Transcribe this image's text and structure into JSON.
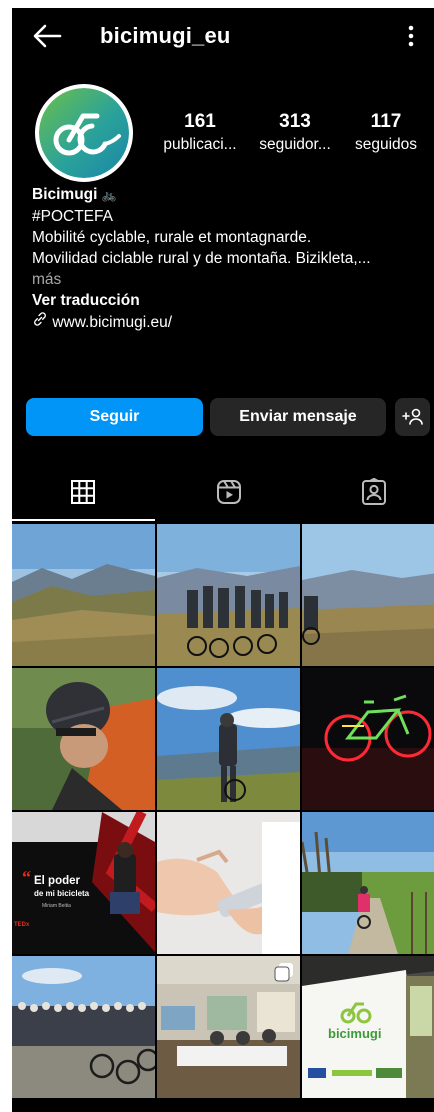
{
  "header": {
    "username": "bicimugi_eu"
  },
  "stats": [
    {
      "value": "161",
      "label": "publicaci..."
    },
    {
      "value": "313",
      "label": "seguidor..."
    },
    {
      "value": "117",
      "label": "seguidos"
    }
  ],
  "bio": {
    "name": "Bicimugi",
    "name_emoji": "🚲",
    "hashtag": "#POCTEFA",
    "line1": "Mobilité cyclable, rurale et montagnarde.",
    "line2": "Movilidad ciclable rural y de montaña. Bizikleta,...",
    "more": "más",
    "translate": "Ver traducción",
    "link": "www.bicimugi.eu/"
  },
  "actions": {
    "follow": "Seguir",
    "message": "Enviar mensaje",
    "add_user": "+"
  },
  "tabs": [
    "grid-icon",
    "reels-icon",
    "tagged-icon"
  ],
  "posts": {
    "post7_title_line1": "El poder",
    "post7_title_line2": "de mi bicicleta",
    "post7_speaker": "Miriam Beitia",
    "post7_brand": "TEDx",
    "post12_logo": "bicimugi"
  },
  "colors": {
    "accent": "#0095f6",
    "button_dark": "#262626",
    "muted": "#a8a8a8",
    "brand_green": "#8cc63f"
  }
}
